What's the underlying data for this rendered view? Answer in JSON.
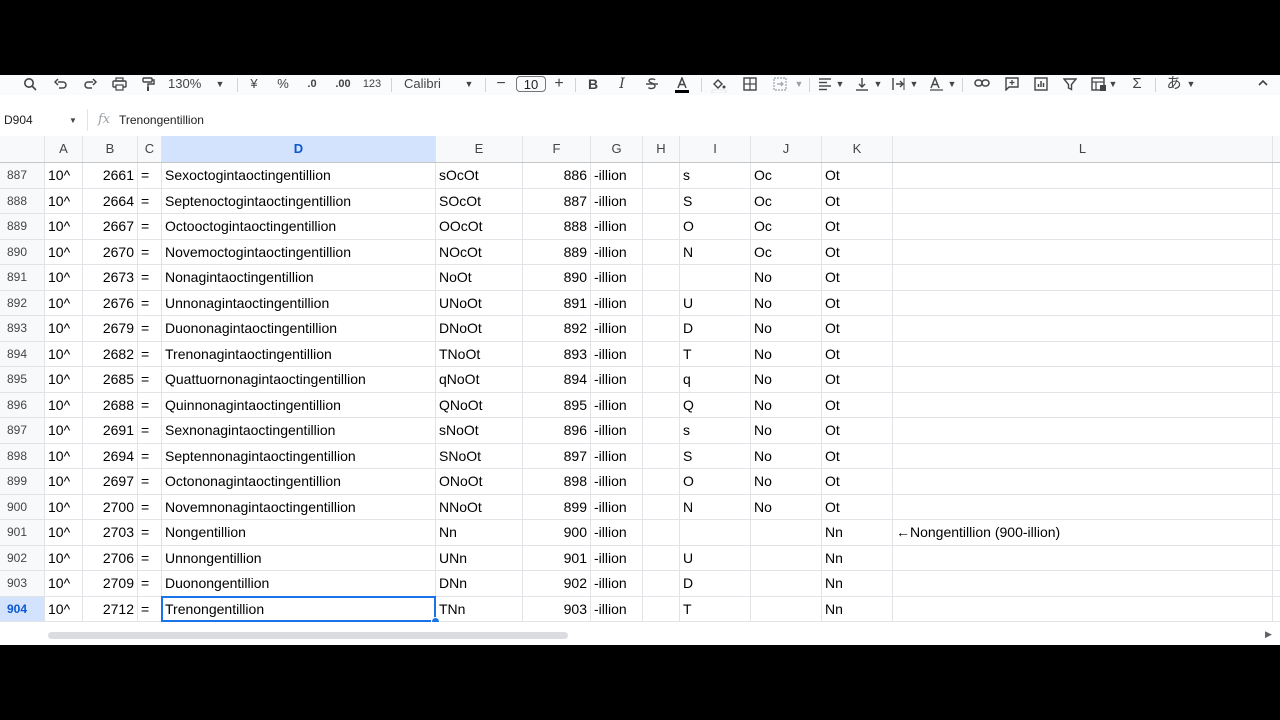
{
  "toolbar": {
    "zoom": "130%",
    "currency": "¥",
    "percent": "%",
    "dec_decrease": ".0",
    "dec_increase": ".00",
    "format_123": "123",
    "font": "Calibri",
    "font_size": "10",
    "bold": "B",
    "italic": "I",
    "input_tool": "あ"
  },
  "formula_bar": {
    "name_box": "D904",
    "fx": "fx",
    "content": "Trenongentillion"
  },
  "columns": [
    "A",
    "B",
    "C",
    "D",
    "E",
    "F",
    "G",
    "H",
    "I",
    "J",
    "K",
    "L"
  ],
  "rows": [
    {
      "n": "887",
      "a": "10^",
      "b": "2661",
      "c": "=",
      "d": "Sexoctogintaoctingentillion",
      "e": "sOcOt",
      "f": "886",
      "g": "-illion",
      "h": "",
      "i": "s",
      "j": "Oc",
      "k": "Ot",
      "l": ""
    },
    {
      "n": "888",
      "a": "10^",
      "b": "2664",
      "c": "=",
      "d": "Septenoctogintaoctingentillion",
      "e": "SOcOt",
      "f": "887",
      "g": "-illion",
      "h": "",
      "i": "S",
      "j": "Oc",
      "k": "Ot",
      "l": ""
    },
    {
      "n": "889",
      "a": "10^",
      "b": "2667",
      "c": "=",
      "d": "Octooctogintaoctingentillion",
      "e": "OOcOt",
      "f": "888",
      "g": "-illion",
      "h": "",
      "i": "O",
      "j": "Oc",
      "k": "Ot",
      "l": ""
    },
    {
      "n": "890",
      "a": "10^",
      "b": "2670",
      "c": "=",
      "d": "Novemoctogintaoctingentillion",
      "e": "NOcOt",
      "f": "889",
      "g": "-illion",
      "h": "",
      "i": "N",
      "j": "Oc",
      "k": "Ot",
      "l": ""
    },
    {
      "n": "891",
      "a": "10^",
      "b": "2673",
      "c": "=",
      "d": "Nonagintaoctingentillion",
      "e": "NoOt",
      "f": "890",
      "g": "-illion",
      "h": "",
      "i": "",
      "j": "No",
      "k": "Ot",
      "l": ""
    },
    {
      "n": "892",
      "a": "10^",
      "b": "2676",
      "c": "=",
      "d": "Unnonagintaoctingentillion",
      "e": "UNoOt",
      "f": "891",
      "g": "-illion",
      "h": "",
      "i": "U",
      "j": "No",
      "k": "Ot",
      "l": ""
    },
    {
      "n": "893",
      "a": "10^",
      "b": "2679",
      "c": "=",
      "d": "Duononagintaoctingentillion",
      "e": "DNoOt",
      "f": "892",
      "g": "-illion",
      "h": "",
      "i": "D",
      "j": "No",
      "k": "Ot",
      "l": ""
    },
    {
      "n": "894",
      "a": "10^",
      "b": "2682",
      "c": "=",
      "d": "Trenonagintaoctingentillion",
      "e": "TNoOt",
      "f": "893",
      "g": "-illion",
      "h": "",
      "i": "T",
      "j": "No",
      "k": "Ot",
      "l": ""
    },
    {
      "n": "895",
      "a": "10^",
      "b": "2685",
      "c": "=",
      "d": "Quattuornonagintaoctingentillion",
      "e": "qNoOt",
      "f": "894",
      "g": "-illion",
      "h": "",
      "i": "q",
      "j": "No",
      "k": "Ot",
      "l": ""
    },
    {
      "n": "896",
      "a": "10^",
      "b": "2688",
      "c": "=",
      "d": "Quinnonagintaoctingentillion",
      "e": "QNoOt",
      "f": "895",
      "g": "-illion",
      "h": "",
      "i": "Q",
      "j": "No",
      "k": "Ot",
      "l": ""
    },
    {
      "n": "897",
      "a": "10^",
      "b": "2691",
      "c": "=",
      "d": "Sexnonagintaoctingentillion",
      "e": "sNoOt",
      "f": "896",
      "g": "-illion",
      "h": "",
      "i": "s",
      "j": "No",
      "k": "Ot",
      "l": ""
    },
    {
      "n": "898",
      "a": "10^",
      "b": "2694",
      "c": "=",
      "d": "Septennonagintaoctingentillion",
      "e": "SNoOt",
      "f": "897",
      "g": "-illion",
      "h": "",
      "i": "S",
      "j": "No",
      "k": "Ot",
      "l": ""
    },
    {
      "n": "899",
      "a": "10^",
      "b": "2697",
      "c": "=",
      "d": "Octononagintaoctingentillion",
      "e": "ONoOt",
      "f": "898",
      "g": "-illion",
      "h": "",
      "i": "O",
      "j": "No",
      "k": "Ot",
      "l": ""
    },
    {
      "n": "900",
      "a": "10^",
      "b": "2700",
      "c": "=",
      "d": "Novemnonagintaoctingentillion",
      "e": "NNoOt",
      "f": "899",
      "g": "-illion",
      "h": "",
      "i": "N",
      "j": "No",
      "k": "Ot",
      "l": ""
    },
    {
      "n": "901",
      "a": "10^",
      "b": "2703",
      "c": "=",
      "d": "Nongentillion",
      "e": "Nn",
      "f": "900",
      "g": "-illion",
      "h": "",
      "i": "",
      "j": "",
      "k": "Nn",
      "l": "←Nongentillion (900-illion)"
    },
    {
      "n": "902",
      "a": "10^",
      "b": "2706",
      "c": "=",
      "d": "Unnongentillion",
      "e": "UNn",
      "f": "901",
      "g": "-illion",
      "h": "",
      "i": "U",
      "j": "",
      "k": "Nn",
      "l": ""
    },
    {
      "n": "903",
      "a": "10^",
      "b": "2709",
      "c": "=",
      "d": "Duonongentillion",
      "e": "DNn",
      "f": "902",
      "g": "-illion",
      "h": "",
      "i": "D",
      "j": "",
      "k": "Nn",
      "l": ""
    },
    {
      "n": "904",
      "a": "10^",
      "b": "2712",
      "c": "=",
      "d": "Trenongentillion",
      "e": "TNn",
      "f": "903",
      "g": "-illion",
      "h": "",
      "i": "T",
      "j": "",
      "k": "Nn",
      "l": ""
    }
  ],
  "selection": {
    "row": "904",
    "column": "D"
  }
}
